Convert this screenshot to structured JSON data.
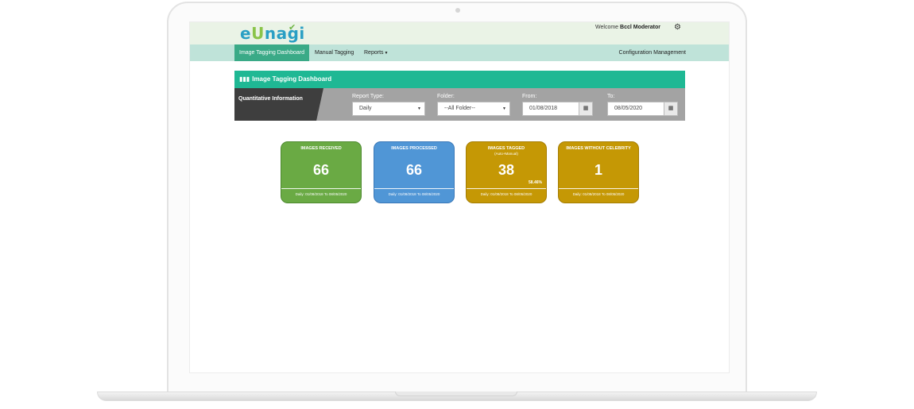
{
  "header": {
    "logo_text_pre": "e",
    "logo_text_u": "U",
    "logo_text_post": "nagi",
    "welcome_prefix": "Welcome",
    "user_name": "Bccl Moderator",
    "settings_icon": "gear-icon"
  },
  "nav": {
    "items": [
      {
        "label": "Image Tagging Dashboard",
        "active": true
      },
      {
        "label": "Manual Tagging",
        "active": false
      },
      {
        "label": "Reports",
        "active": false
      }
    ],
    "right_item": "Configuration Management"
  },
  "dashboard": {
    "title": "Image Tagging Dashboard",
    "title_icon": "bar-chart-icon"
  },
  "filters": {
    "section_label": "Quantitative Information",
    "report_type": {
      "label": "Report Type:",
      "value": "Daily"
    },
    "folder": {
      "label": "Folder:",
      "value": "--All Folder--"
    },
    "from": {
      "label": "From:",
      "value": "01/08/2018"
    },
    "to": {
      "label": "To:",
      "value": "08/05/2020"
    }
  },
  "cards": [
    {
      "title": "IMAGES RECEIVED",
      "subtitle": "",
      "value": "66",
      "percent": "",
      "footer": "Daily: 01/08/2018 To 08/05/2020",
      "color": "#6aaa44",
      "border": "#4e8a30"
    },
    {
      "title": "IMAGES PROCESSED",
      "subtitle": "",
      "value": "66",
      "percent": "",
      "footer": "Daily: 01/08/2018 To 08/05/2020",
      "color": "#5096d6",
      "border": "#3a78b8"
    },
    {
      "title": "IMAGES TAGGED",
      "subtitle": "(Auto+Manual)",
      "value": "38",
      "percent": "58.46%",
      "footer": "Daily: 01/08/2018 To 08/05/2020",
      "color": "#c59805",
      "border": "#a57d02"
    },
    {
      "title": "IMAGES WITHOUT CELEBRITY",
      "subtitle": "",
      "value": "1",
      "percent": "",
      "footer": "Daily: 01/08/2018 To 08/05/2020",
      "color": "#c59805",
      "border": "#a57d02"
    }
  ]
}
